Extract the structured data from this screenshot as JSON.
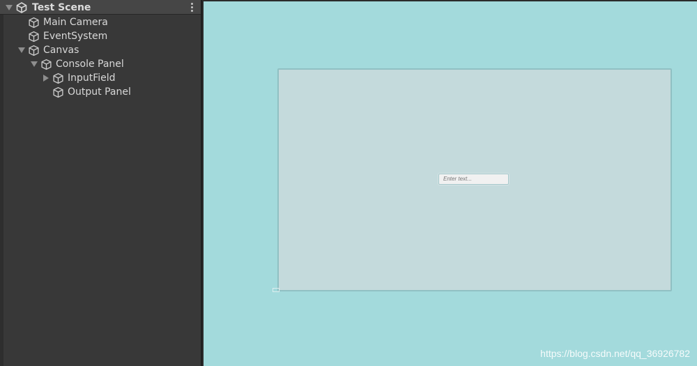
{
  "hierarchy": {
    "scene_title": "Test Scene",
    "items": [
      {
        "label": "Main Camera",
        "expander": "none"
      },
      {
        "label": "EventSystem",
        "expander": "none"
      },
      {
        "label": "Canvas",
        "expander": "expanded"
      },
      {
        "label": "Console Panel",
        "expander": "expanded"
      },
      {
        "label": "InputField",
        "expander": "collapsed"
      },
      {
        "label": "Output Panel",
        "expander": "none"
      }
    ]
  },
  "scene": {
    "input_placeholder": "Enter text...",
    "watermark": "https://blog.csdn.net/qq_36926782"
  },
  "colors": {
    "panel_bg": "#383838",
    "scene_bg": "#a3dadc",
    "console_panel_bg": "#c4dadc"
  }
}
